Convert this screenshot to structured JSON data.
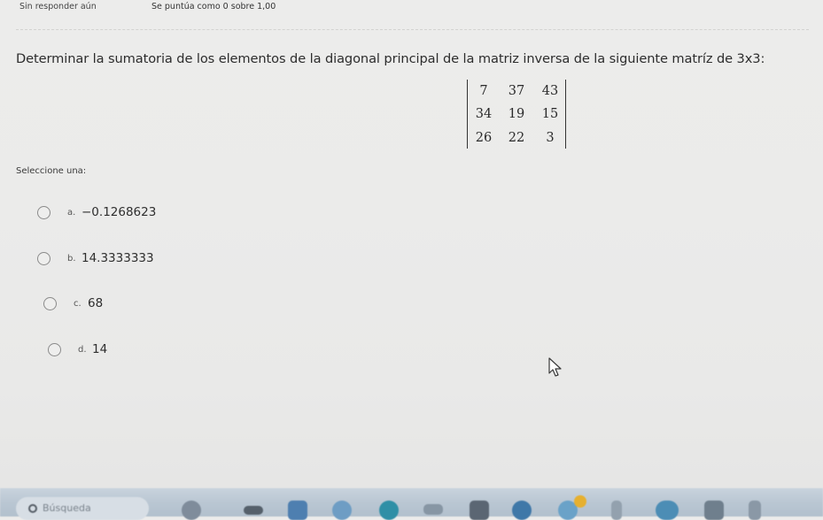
{
  "question_info": {
    "state": "Sin responder aún",
    "grade": "Se puntúa como 0 sobre 1,00"
  },
  "question": {
    "text": "Determinar la sumatoria de los elementos de la diagonal principal de la matriz inversa de la siguiente matríz de 3x3:",
    "matrix": [
      [
        "7",
        "37",
        "43"
      ],
      [
        "34",
        "19",
        "15"
      ],
      [
        "26",
        "22",
        "3"
      ]
    ]
  },
  "answer": {
    "prompt": "Seleccione una:",
    "options": [
      {
        "letter": "a.",
        "value": "−0.1268623"
      },
      {
        "letter": "b.",
        "value": "14.3333333"
      },
      {
        "letter": "c.",
        "value": "68"
      },
      {
        "letter": "d.",
        "value": "14"
      }
    ]
  },
  "taskbar": {
    "search_placeholder": "Búsqueda",
    "icons": [
      "search-icon",
      "browser-icon",
      "file-explorer-icon",
      "calendar-icon",
      "weather-icon",
      "edge-icon",
      "mail-icon",
      "app-icon",
      "app-icon",
      "chrome-icon",
      "app-icon",
      "app-icon",
      "app-icon",
      "app-icon"
    ]
  }
}
